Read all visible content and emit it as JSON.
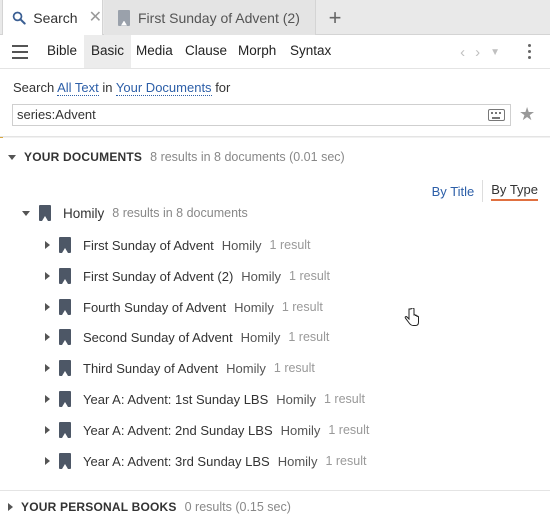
{
  "tabs": [
    {
      "label": "Search",
      "icon": "search-icon",
      "active": true,
      "close": "✕"
    },
    {
      "label": "First Sunday of Advent (2)",
      "icon": "book-icon",
      "active": false
    }
  ],
  "add_tab": "+",
  "toolbar": {
    "menu_icon": "hamburger-icon",
    "tabs": [
      "Bible",
      "Basic",
      "Media",
      "Clause",
      "Morph",
      "Syntax"
    ],
    "active_tab": "Basic"
  },
  "search": {
    "prefix": "Search",
    "scope": "All Text",
    "in": "in",
    "source": "Your Documents",
    "suffix": "for",
    "query": "series:Advent"
  },
  "sections": {
    "documents": {
      "title": "YOUR DOCUMENTS",
      "summary": "8 results in 8 documents (0.01 sec)"
    },
    "personal": {
      "title": "YOUR PERSONAL BOOKS",
      "summary": "0 results (0.15 sec)"
    }
  },
  "sort": {
    "by_title": "By Title",
    "by_type": "By Type",
    "selected": "By Type"
  },
  "group": {
    "label": "Homily",
    "summary": "8 results in 8 documents"
  },
  "items": [
    {
      "title": "First Sunday of Advent",
      "type": "Homily",
      "count": "1 result"
    },
    {
      "title": "First Sunday of Advent (2)",
      "type": "Homily",
      "count": "1 result"
    },
    {
      "title": "Fourth Sunday of Advent",
      "type": "Homily",
      "count": "1 result"
    },
    {
      "title": "Second Sunday of Advent",
      "type": "Homily",
      "count": "1 result"
    },
    {
      "title": "Third Sunday of Advent",
      "type": "Homily",
      "count": "1 result"
    },
    {
      "title": "Year A: Advent: 1st Sunday LBS",
      "type": "Homily",
      "count": "1 result"
    },
    {
      "title": "Year A: Advent: 2nd Sunday LBS",
      "type": "Homily",
      "count": "1 result"
    },
    {
      "title": "Year A: Advent: 3rd Sunday LBS",
      "type": "Homily",
      "count": "1 result"
    }
  ],
  "colors": {
    "link": "#2d5fa8",
    "accent": "#e07040",
    "book_icon": "#4d5766"
  }
}
